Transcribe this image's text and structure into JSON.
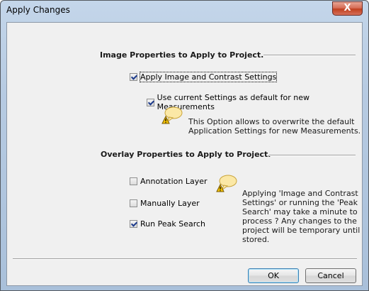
{
  "window": {
    "title": "Apply Changes",
    "close_glyph": "X"
  },
  "image_section": {
    "heading": "Image Properties to Apply to Project.",
    "apply_image_contrast": {
      "label": "Apply Image and Contrast Settings",
      "checked": true
    },
    "use_current_default": {
      "label": "Use current Settings as default for new Measurements",
      "checked": true
    },
    "note_icon": "warning-speech-bubble-icon",
    "note_lines": [
      "This Option allows to overwrite the default",
      "Application Settings for new Measurements."
    ]
  },
  "overlay_section": {
    "heading": "Overlay Properties to Apply to Project.",
    "annotation_layer": {
      "label": "Annotation Layer",
      "checked": false
    },
    "manually_layer": {
      "label": "Manually Layer",
      "checked": false
    },
    "run_peak_search": {
      "label": "Run Peak Search",
      "checked": true
    },
    "note_icon": "warning-speech-bubble-icon",
    "note_lines": [
      "Applying 'Image and Contrast",
      "Settings' or running the 'Peak",
      "Search' may take a minute to",
      "process ? Any changes to the",
      "project will be temporary until",
      "stored."
    ]
  },
  "buttons": {
    "ok": "OK",
    "cancel": "Cancel"
  }
}
